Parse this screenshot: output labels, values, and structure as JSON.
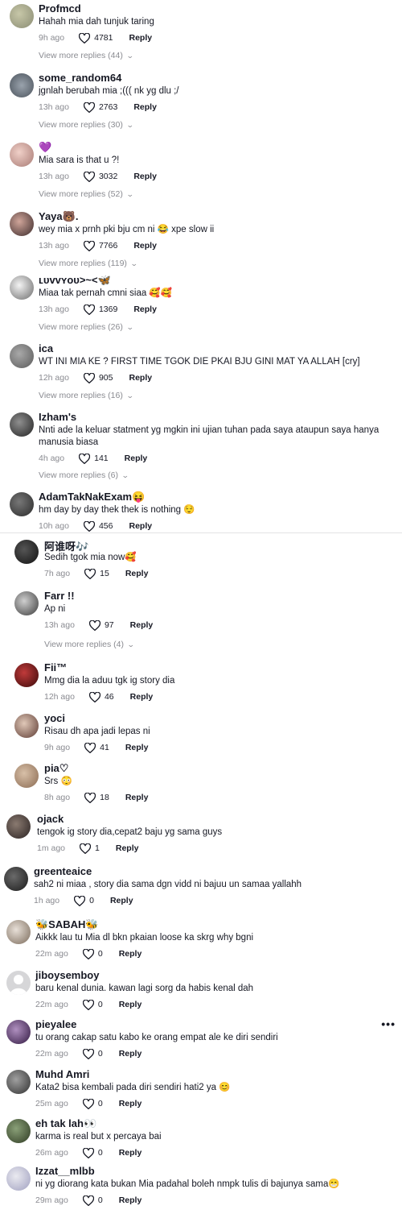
{
  "comments": [
    {
      "username": "Profmcd",
      "text": "Hahah mia dah tunjuk taring",
      "time": "9h ago",
      "likes": "4781",
      "reply": "Reply",
      "view_more": "View more replies (44)"
    },
    {
      "username": "some_random64",
      "text": "jgnlah berubah mia ;((( nk yg dlu ;/",
      "time": "13h ago",
      "likes": "2763",
      "reply": "Reply",
      "view_more": "View more replies (30)"
    },
    {
      "username": "💜",
      "text": "Mia sara is that u ?!",
      "time": "13h ago",
      "likes": "3032",
      "reply": "Reply",
      "view_more": "View more replies (52)"
    },
    {
      "username": "Yaya🐻.",
      "text": "wey mia x prnh pki bju cm ni 😂 xpe slow ii",
      "time": "13h ago",
      "likes": "7766",
      "reply": "Reply",
      "view_more": "View more replies (119)"
    },
    {
      "username": "ʟᴜᴠᴠʏᴏᴜ>~<🦋",
      "text": "Miaa tak pernah cmni siaa 🥰🥰",
      "time": "13h ago",
      "likes": "1369",
      "reply": "Reply",
      "view_more": "View more replies (26)"
    },
    {
      "username": "ica",
      "text": "WT INI MIA KE ? FIRST TIME TGOK DIE PKAI BJU GINI MAT YA ALLAH [cry]",
      "time": "12h ago",
      "likes": "905",
      "reply": "Reply",
      "view_more": "View more replies (16)"
    },
    {
      "username": "Izham's",
      "text": "Nnti ade la keluar statment yg mgkin ini ujian tuhan pada saya ataupun saya hanya manusia biasa",
      "time": "4h ago",
      "likes": "141",
      "reply": "Reply",
      "view_more": "View more replies (6)"
    },
    {
      "username": "AdamTakNakExam😝",
      "text": "hm day by day thek thek is nothing 😌",
      "time": "10h ago",
      "likes": "456",
      "reply": "Reply",
      "view_more": ""
    },
    {
      "username": "阿谁呀🎶",
      "text": "Sedih tgok mia now🥰",
      "time": "7h ago",
      "likes": "15",
      "reply": "Reply",
      "view_more": ""
    },
    {
      "username": "Farr !!",
      "text": "Ap ni",
      "time": "13h ago",
      "likes": "97",
      "reply": "Reply",
      "view_more": "View more replies (4)"
    },
    {
      "username": "Fii™",
      "text": "Mmg dia la aduu tgk ig story dia",
      "time": "12h ago",
      "likes": "46",
      "reply": "Reply",
      "view_more": ""
    },
    {
      "username": "yoci",
      "text": "Risau dh apa jadi lepas ni",
      "time": "9h ago",
      "likes": "41",
      "reply": "Reply",
      "view_more": ""
    },
    {
      "username": "pia♡",
      "text": "Srs 😳",
      "time": "8h ago",
      "likes": "18",
      "reply": "Reply",
      "view_more": ""
    },
    {
      "username": "ojack",
      "text": "tengok ig story dia,cepat2 baju yg sama guys",
      "time": "1m ago",
      "likes": "1",
      "reply": "Reply",
      "view_more": ""
    },
    {
      "username": "greenteaice",
      "text": "sah2 ni miaa , story dia sama dgn vidd ni bajuu un samaa yallahh",
      "time": "1h ago",
      "likes": "0",
      "reply": "Reply",
      "view_more": ""
    },
    {
      "username": "🐝SABAH🐝",
      "text": "Aikkk lau tu Mia dl bkn pkaian loose ka skrg why bgni",
      "time": "22m ago",
      "likes": "0",
      "reply": "Reply",
      "view_more": ""
    },
    {
      "username": "jiboysemboy",
      "text": "baru kenal dunia. kawan lagi sorg da habis kenal dah",
      "time": "22m ago",
      "likes": "0",
      "reply": "Reply",
      "view_more": ""
    },
    {
      "username": "pieyalee",
      "text": "tu orang cakap satu kabo ke orang empat ale ke diri sendiri",
      "time": "22m ago",
      "likes": "0",
      "reply": "Reply",
      "view_more": ""
    },
    {
      "username": "Muhd Amri",
      "text": "Kata2 bisa kembali pada diri sendiri hati2 ya 😊",
      "time": "25m ago",
      "likes": "0",
      "reply": "Reply",
      "view_more": ""
    },
    {
      "username": "eh tak lah👀",
      "text": "karma is real but x percaya bai",
      "time": "26m ago",
      "likes": "0",
      "reply": "Reply",
      "view_more": ""
    },
    {
      "username": "Izzat__mlbb",
      "text": "ni yg diorang kata bukan Mia padahal boleh nmpk tulis di bajunya sama😁",
      "time": "29m ago",
      "likes": "0",
      "reply": "Reply",
      "view_more": ""
    }
  ],
  "more_options": "•••",
  "colors": {
    "text": "#161823",
    "muted": "#8a8b91",
    "divider": "#e3e3e4",
    "background": "#ffffff"
  }
}
